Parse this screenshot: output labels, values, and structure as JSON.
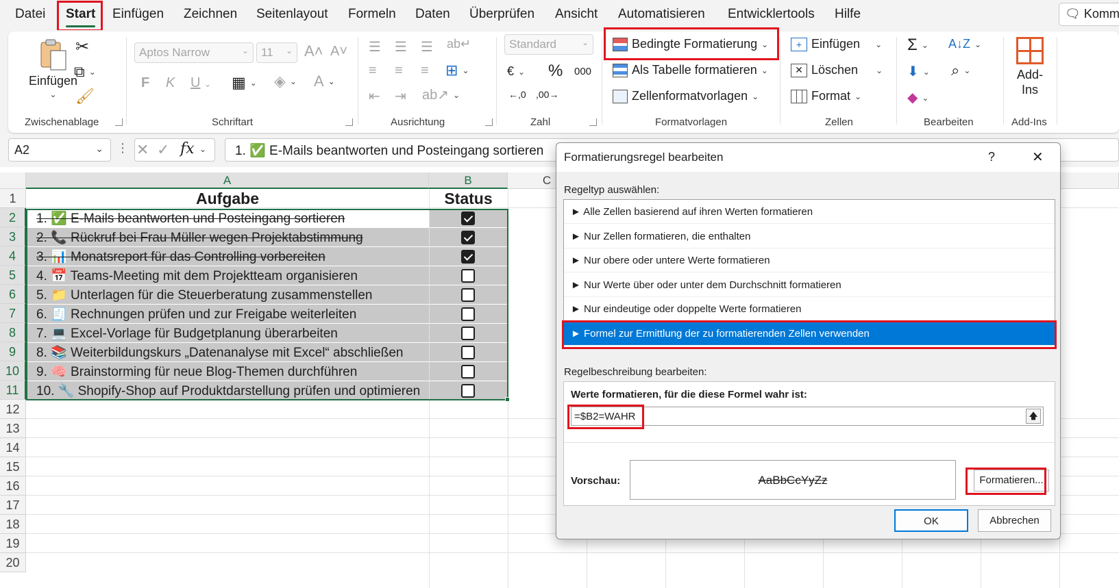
{
  "menu": {
    "tabs": [
      "Datei",
      "Start",
      "Einfügen",
      "Zeichnen",
      "Seitenlayout",
      "Formeln",
      "Daten",
      "Überprüfen",
      "Ansicht",
      "Automatisieren",
      "Entwicklertools",
      "Hilfe"
    ],
    "active_tab": "Start",
    "comment_button": "Komm"
  },
  "ribbon": {
    "clipboard": {
      "paste": "Einfügen",
      "group": "Zwischenablage"
    },
    "font": {
      "name": "Aptos Narrow",
      "size": "11",
      "bold": "F",
      "italic": "K",
      "underline": "U",
      "group": "Schriftart"
    },
    "alignment": {
      "group": "Ausrichtung"
    },
    "number": {
      "format": "Standard",
      "percent": "%",
      "thousands": "000",
      "group": "Zahl"
    },
    "styles": {
      "conditional": "Bedingte Formatierung",
      "as_table": "Als Tabelle formatieren",
      "cell_styles": "Zellenformatvorlagen",
      "group": "Formatvorlagen"
    },
    "cells": {
      "insert": "Einfügen",
      "delete": "Löschen",
      "format": "Format",
      "group": "Zellen"
    },
    "editing": {
      "group": "Bearbeiten"
    },
    "addins": {
      "label": "Add-Ins",
      "group": "Add-Ins"
    }
  },
  "formula_bar": {
    "name_box": "A2",
    "formula": "1. ✅ E-Mails beantworten und Posteingang sortieren"
  },
  "sheet": {
    "columns": [
      "A",
      "B",
      "C"
    ],
    "row_numbers": [
      "1",
      "2",
      "3",
      "4",
      "5",
      "6",
      "7",
      "8",
      "9",
      "10",
      "11",
      "12",
      "13",
      "14",
      "15",
      "16",
      "17",
      "18",
      "19",
      "20"
    ],
    "header": {
      "task": "Aufgabe",
      "status": "Status"
    },
    "rows": [
      {
        "text": "1. ✅ E-Mails beantworten und Posteingang sortieren",
        "done": true
      },
      {
        "text": "2. 📞 Rückruf bei Frau Müller wegen Projektabstimmung",
        "done": true
      },
      {
        "text": "3. 📊 Monatsreport für das Controlling vorbereiten",
        "done": true
      },
      {
        "text": "4. 📅 Teams-Meeting mit dem Projektteam organisieren",
        "done": false
      },
      {
        "text": "5. 📁 Unterlagen für die Steuerberatung zusammenstellen",
        "done": false
      },
      {
        "text": "6. 🧾 Rechnungen prüfen und zur Freigabe weiterleiten",
        "done": false
      },
      {
        "text": "7. 💻 Excel-Vorlage für Budgetplanung überarbeiten",
        "done": false
      },
      {
        "text": "8. 📚 Weiterbildungskurs „Datenanalyse mit Excel“ abschließen",
        "done": false
      },
      {
        "text": "9. 🧠 Brainstorming für neue Blog-Themen durchführen",
        "done": false
      },
      {
        "text": "10. 🔧 Shopify-Shop auf Produktdarstellung prüfen und optimieren",
        "done": false
      }
    ]
  },
  "dialog": {
    "title": "Formatierungsregel bearbeiten",
    "help": "?",
    "close": "✕",
    "rule_type_label": "Regeltyp auswählen:",
    "rule_types": [
      "► Alle Zellen basierend auf ihren Werten formatieren",
      "► Nur Zellen formatieren, die enthalten",
      "► Nur obere oder untere Werte formatieren",
      "► Nur Werte über oder unter dem Durchschnitt formatieren",
      "► Nur eindeutige oder doppelte Werte formatieren",
      "► Formel zur Ermittlung der zu formatierenden Zellen verwenden"
    ],
    "selected_rule_index": 5,
    "description_label": "Regelbeschreibung bearbeiten:",
    "formula_title": "Werte formatieren, für die diese Formel wahr ist:",
    "formula_value": "=$B2=WAHR",
    "preview_label": "Vorschau:",
    "preview_text": "AaBbCcYyZz",
    "format_button": "Formatieren...",
    "ok": "OK",
    "cancel": "Abbrechen"
  },
  "colors": {
    "accent_green": "#1e7145",
    "highlight_red": "#e0141e",
    "selection_blue": "#0078d7",
    "done_fill": "#c8c8c8"
  }
}
